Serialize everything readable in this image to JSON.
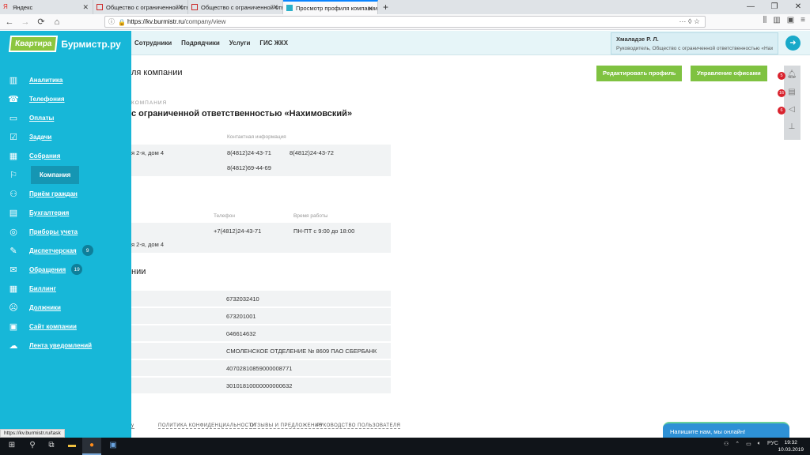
{
  "browser": {
    "tabs": [
      {
        "title": "Яндекс",
        "color": "#e52620"
      },
      {
        "title": "Общество с ограниченной ответственностью",
        "color": "#cc2a2a"
      },
      {
        "title": "Общество с ограниченной ответственностью",
        "color": "#cc2a2a"
      },
      {
        "title": "Просмотр профиля компании",
        "color": "#2bb0c9"
      }
    ],
    "new_tab": "+",
    "url_domain": "https://kv.burmistr.ru",
    "url_path": "/company/view",
    "url_menu": "···"
  },
  "app": {
    "logo_box": "Квартира",
    "logo_text": "Бурмистр.ру",
    "topnav": [
      "Сотрудники",
      "Подрядчики",
      "Услуги",
      "ГИС ЖКХ"
    ],
    "user_name": "Хмаладзе Р. Л.",
    "user_role": "Руководитель, Общество с ограниченной ответственностью «Нах...",
    "sidebar": [
      {
        "label": "Аналитика",
        "icon": "analytics-icon"
      },
      {
        "label": "Телефония",
        "icon": "phone-icon"
      },
      {
        "label": "Оплаты",
        "icon": "payments-icon"
      },
      {
        "label": "Задачи",
        "icon": "tasks-icon"
      },
      {
        "label": "Собрания",
        "icon": "meetings-icon"
      },
      {
        "label": "Компания",
        "icon": "company-icon"
      },
      {
        "label": "Приём граждан",
        "icon": "reception-icon"
      },
      {
        "label": "Бухгалтерия",
        "icon": "accounting-icon"
      },
      {
        "label": "Приборы учета",
        "icon": "meters-icon"
      },
      {
        "label": "Диспетчерская",
        "icon": "dispatch-icon",
        "badge": "9"
      },
      {
        "label": "Обращения",
        "icon": "requests-icon",
        "badge": "19"
      },
      {
        "label": "Биллинг",
        "icon": "billing-icon"
      },
      {
        "label": "Должники",
        "icon": "debtors-icon"
      },
      {
        "label": "Сайт компании",
        "icon": "site-icon"
      },
      {
        "label": "Лента уведомлений",
        "icon": "feed-icon"
      }
    ]
  },
  "page": {
    "title_fragment": "ля компании",
    "edit_button": "Редактировать профиль",
    "offices_button": "Управление офисами",
    "company_caption": "КОМПАНИЯ",
    "company_name": "с ограниченной ответственностью «Нахимовский»",
    "contacts_label": "Контактная информация",
    "address1": "я 2-я, дом 4",
    "phone1": "8(4812)24-43-71",
    "phone2": "8(4812)24-43-72",
    "phone3": "8(4812)69-44-69",
    "phone_label": "Телефон",
    "hours_label": "Время работы",
    "office_phone": "+7(4812)24-43-71",
    "office_hours": "ПН-ПТ с 9:00 до 18:00",
    "address2": "я 2-я, дом 4",
    "requisites_title": "нии",
    "requisites": [
      "6732032410",
      "673201001",
      "046614632",
      "СМОЛЕНСКОЕ ОТДЕЛЕНИЕ № 8609 ПАО СБЕРБАНК",
      "40702810859000008771",
      "30101810000000000632"
    ],
    "footer_links": [
      "ПОЛИТИКА КОНФИДЕНЦИАЛЬНОСТИ",
      "ОТЗЫВЫ И ПРЕДЛОЖЕНИЯ",
      "РУКОВОДСТВО ПОЛЬЗОВАТЕЛЯ"
    ],
    "footer_stub": "у"
  },
  "right_panel": {
    "badges": [
      "5",
      "16",
      "6"
    ]
  },
  "chat": "Напишите нам, мы онлайн!",
  "status_url": "https://kv.burmistr.ru/task",
  "taskbar": {
    "lang": "РУС",
    "time": "19:32",
    "date": "10.03.2019"
  }
}
